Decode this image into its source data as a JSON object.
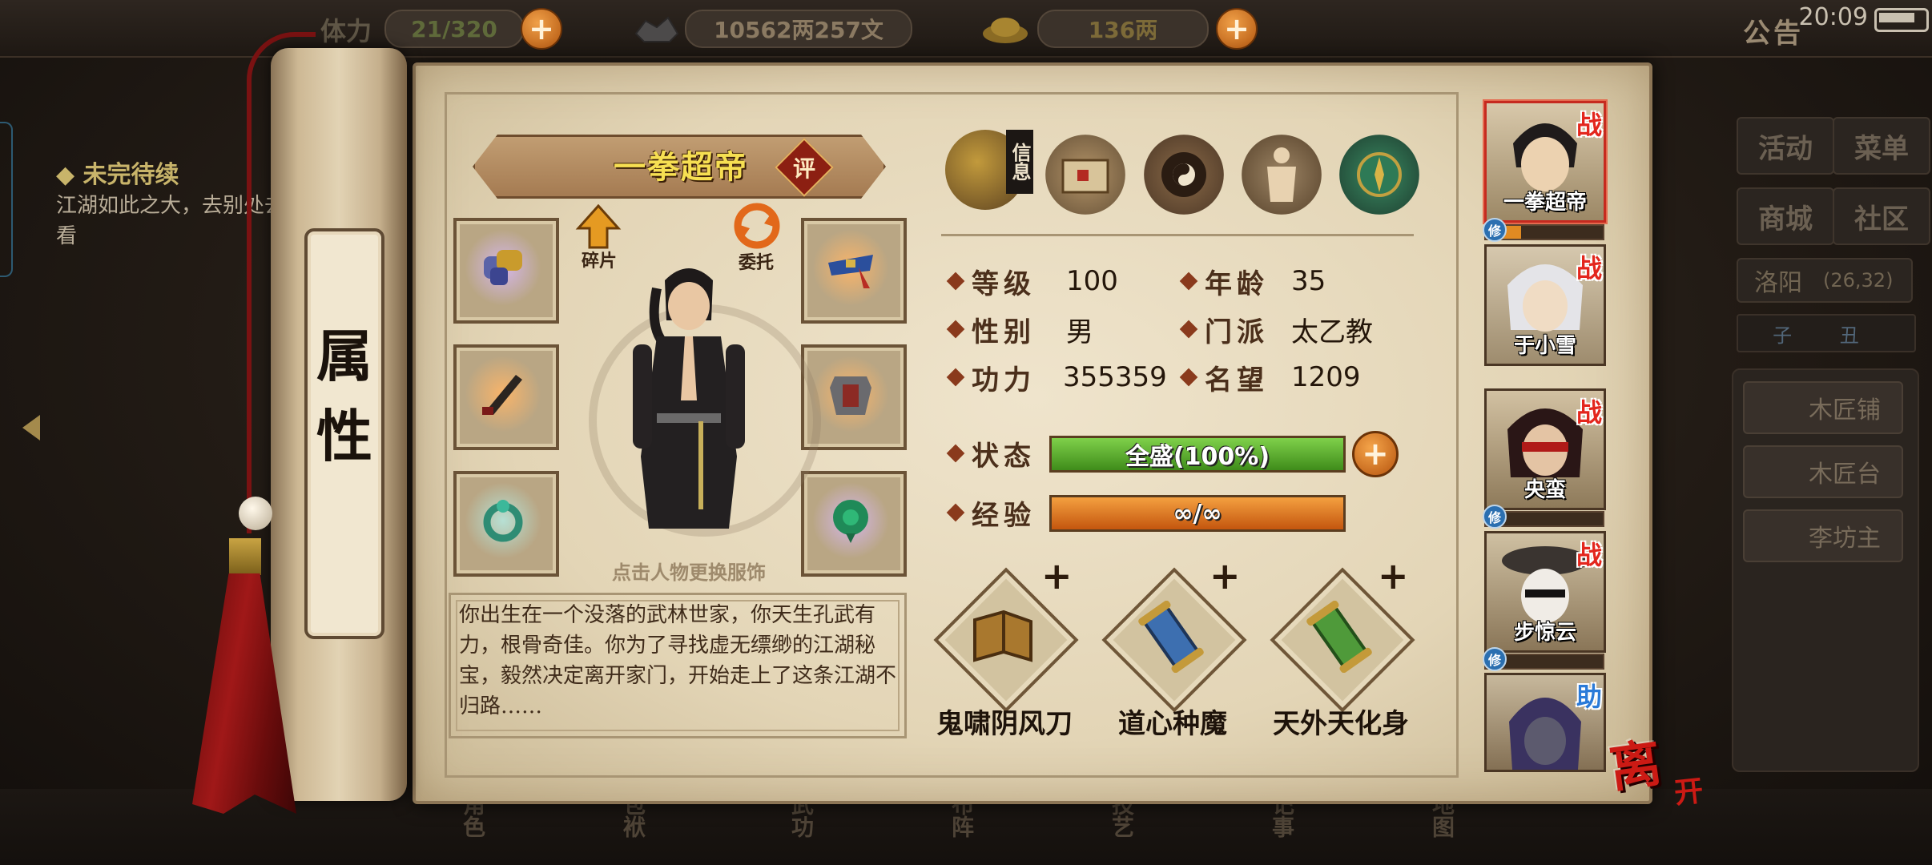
{
  "topbar": {
    "stamina_label": "体力",
    "stamina": "21/320",
    "silver": "10562两257文",
    "gold": "136两",
    "notice": "公告",
    "clock": "20:09"
  },
  "left": {
    "quest_title": "未完待续",
    "quest_text": "江湖如此之大，去别处去看看"
  },
  "right_panel": {
    "buttons": [
      "活动",
      "菜单",
      "商城",
      "社区"
    ],
    "location": "洛阳",
    "coords": "(26,32)",
    "time_marks": "子 丑",
    "npcs": [
      "木匠铺",
      "木匠台",
      "李坊主"
    ]
  },
  "bottom_nav": [
    "角色",
    "包袱",
    "武功",
    "布阵",
    "技艺",
    "记事",
    "地图"
  ],
  "scroll": {
    "title": "属性"
  },
  "character": {
    "name": "一拳超帝",
    "rate_badge": "评",
    "shard_label": "碎片",
    "entrust_label": "委托",
    "change_hint": "点击人物更换服饰",
    "bio": "你出生在一个没落的武林世家，你天生孔武有力，根骨奇佳。你为了寻找虚无缥缈的江湖秘宝，毅然决定离开家门，开始走上了这条江湖不归路……"
  },
  "tabs": {
    "info_label": "信息",
    "items": [
      {
        "icon": "hat-info-icon"
      },
      {
        "icon": "treasure-map-icon"
      },
      {
        "icon": "bagua-icon"
      },
      {
        "icon": "body-meridian-icon"
      },
      {
        "icon": "compass-icon"
      }
    ]
  },
  "attributes": {
    "level_label": "等级",
    "level": "100",
    "age_label": "年龄",
    "age": "35",
    "gender_label": "性别",
    "gender": "男",
    "sect_label": "门派",
    "sect": "太乙教",
    "power_label": "功力",
    "power": "355359",
    "fame_label": "名望",
    "fame": "1209",
    "status_label": "状态",
    "status_text": "全盛(100%)",
    "status_fraction": 1.0,
    "exp_label": "经验",
    "exp_text": "∞/∞",
    "exp_fraction": 1.0
  },
  "skills": [
    {
      "name": "鬼啸阴风刀",
      "icon": "book-icon"
    },
    {
      "name": "道心种魔",
      "icon": "scroll-blue-icon"
    },
    {
      "name": "天外天化身",
      "icon": "scroll-green-icon"
    }
  ],
  "party": [
    {
      "name": "一拳超帝",
      "tag": "战",
      "tag_type": "fight",
      "selected": true,
      "xiu": 0.3
    },
    {
      "name": "于小雪",
      "tag": "战",
      "tag_type": "fight",
      "selected": false
    },
    {
      "name": "央蛮",
      "tag": "战",
      "tag_type": "fight",
      "selected": false,
      "xiu": 0.1
    },
    {
      "name": "步惊云",
      "tag": "战",
      "tag_type": "fight",
      "selected": false,
      "xiu": 0.15
    },
    {
      "name": "",
      "tag": "助",
      "tag_type": "help",
      "selected": false
    }
  ],
  "xiu_label": "修",
  "leave": {
    "big": "离",
    "small": "开"
  },
  "colors": {
    "status_bar": "#5fb02c",
    "exp_bar": "#e0781c",
    "name_gold": "#f6df52",
    "accent_red": "#cc1a14"
  }
}
